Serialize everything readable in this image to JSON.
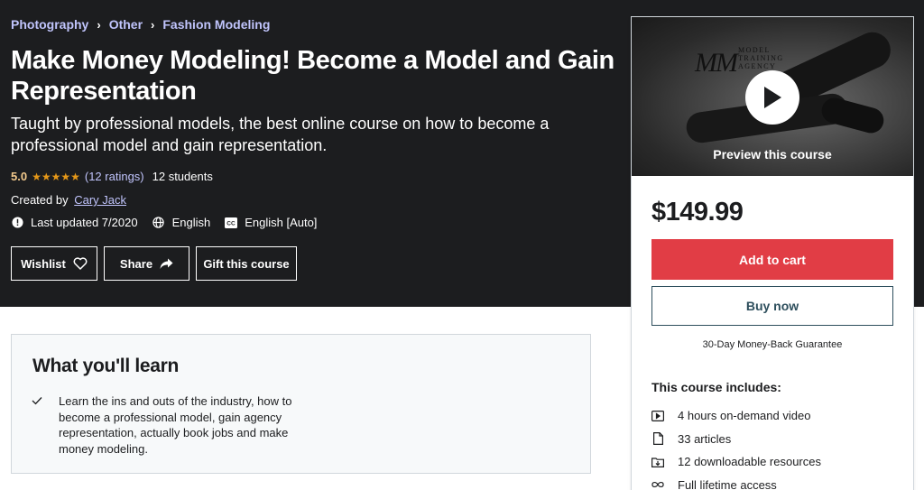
{
  "breadcrumb": {
    "items": [
      "Photography",
      "Other",
      "Fashion Modeling"
    ],
    "separator": "›"
  },
  "course": {
    "title": "Make Money Modeling! Become a Model and Gain Representation",
    "subtitle": "Taught by professional models, the best online course on how to become a professional model and gain representation.",
    "rating": "5.0",
    "stars": "★★★★★",
    "rating_count": "(12 ratings)",
    "students": "12 students",
    "created_by_label": "Created by",
    "author": "Cary Jack",
    "last_updated": "Last updated 7/2020",
    "language": "English",
    "captions": "English [Auto]"
  },
  "actions": {
    "wishlist": "Wishlist",
    "share": "Share",
    "gift": "Gift this course"
  },
  "learn": {
    "title": "What you'll learn",
    "items": [
      "Learn the ins and outs of the industry, how to become a professional model, gain agency representation, actually book jobs and make money modeling."
    ]
  },
  "sidebar": {
    "preview": {
      "logo_mark": "MM",
      "logo_lines": [
        "MODEL",
        "TRAINING",
        "AGENCY"
      ],
      "label": "Preview this course"
    },
    "price": "$149.99",
    "add_to_cart": "Add to cart",
    "buy_now": "Buy now",
    "guarantee": "30-Day Money-Back Guarantee",
    "includes_title": "This course includes:",
    "includes": [
      {
        "icon": "video-icon",
        "text": "4 hours on-demand video"
      },
      {
        "icon": "article-icon",
        "text": "33 articles"
      },
      {
        "icon": "download-icon",
        "text": "12 downloadable resources"
      },
      {
        "icon": "infinity-icon",
        "text": "Full lifetime access"
      }
    ]
  },
  "colors": {
    "hero_bg": "#1c1d1f",
    "link": "#c0c4fc",
    "rating": "#f3ca8c",
    "star": "#e59819",
    "cart": "#e13d45",
    "buy_border": "#2d4e5c"
  }
}
